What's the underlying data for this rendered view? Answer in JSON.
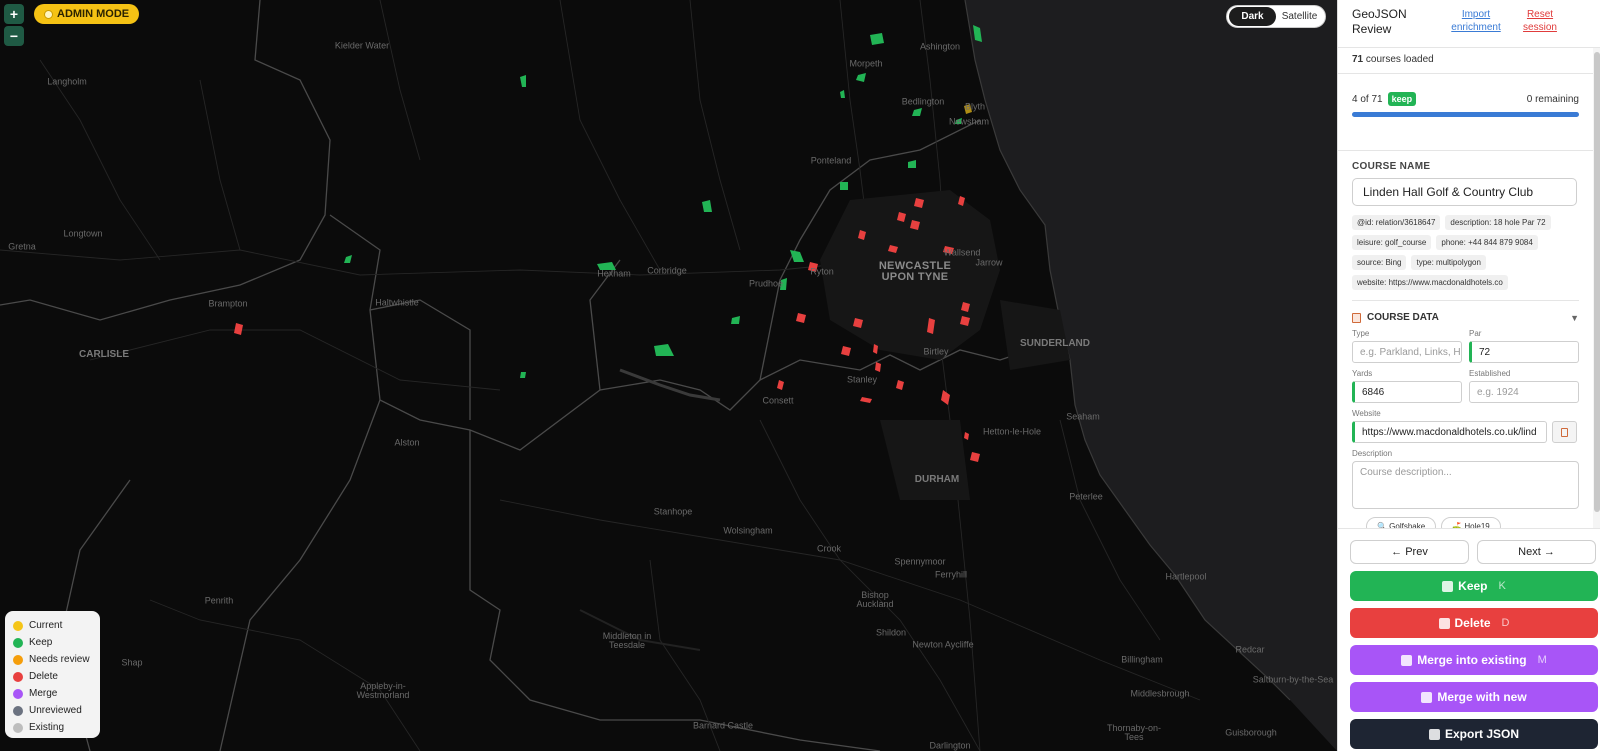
{
  "map": {
    "admin_mode_label": "ADMIN MODE",
    "zoom_in": "+",
    "zoom_out": "−",
    "style_options": [
      "Dark",
      "Satellite"
    ],
    "active_style": "Dark",
    "places": {
      "newcastle": "NEWCASTLE UPON TYNE",
      "sunderland": "SUNDERLAND",
      "durham": "DURHAM",
      "carlisle": "CARLISLE",
      "ashington": "Ashington",
      "morpeth": "Morpeth",
      "bedlington": "Bedlington",
      "blyth": "Blyth",
      "newsham": "Newsham",
      "ponteland": "Ponteland",
      "wallsend": "Wallsend",
      "jarrow": "Jarrow",
      "ryton": "Ryton",
      "prudhoe": "Prudhoe",
      "hexham": "Hexham",
      "corbridge": "Corbridge",
      "haltwhistle": "Haltwhistle",
      "brampton": "Brampton",
      "longtown": "Longtown",
      "langholm": "Langholm",
      "gretna": "Gretna",
      "kielder": "Kielder Water",
      "birtley": "Birtley",
      "stanley": "Stanley",
      "consett": "Consett",
      "alston": "Alston",
      "seaham": "Seaham",
      "houghton": "Hetton-le-Hole",
      "peterlee": "Peterlee",
      "stanhope": "Stanhope",
      "wolsingham": "Wolsingham",
      "crook": "Crook",
      "spennymoor": "Spennymoor",
      "ferryhill": "Ferryhill",
      "bishop": "Bishop Auckland",
      "shildon": "Shildon",
      "newton": "Newton Aycliffe",
      "hartlepool": "Hartlepool",
      "penrith": "Penrith",
      "middleton": "Middleton in Teesdale",
      "appleby": "Appleby-in-Westmorland",
      "barnard": "Barnard Castle",
      "darlington": "Darlington",
      "billingham": "Billingham",
      "middlesbrough": "Middlesbrough",
      "thornaby": "Thornaby-on-Tees",
      "guisborough": "Guisborough",
      "saltburn": "Saltburn-by-the-Sea",
      "redcar": "Redcar",
      "shap": "Shap"
    },
    "legend": [
      {
        "label": "Current",
        "color": "#f5c518"
      },
      {
        "label": "Keep",
        "color": "#22b455"
      },
      {
        "label": "Needs review",
        "color": "#f59e0b"
      },
      {
        "label": "Delete",
        "color": "#e8403f"
      },
      {
        "label": "Merge",
        "color": "#a855f7"
      },
      {
        "label": "Unreviewed",
        "color": "#6b7280"
      },
      {
        "label": "Existing",
        "color": "#bdbdbd"
      }
    ]
  },
  "panel": {
    "title": "GeoJSON Review",
    "import_link": "Import enrichment",
    "reset_link": "Reset session",
    "loaded_count": "71",
    "loaded_suffix": "courses loaded",
    "position": "4 of 71",
    "status_badge": "keep",
    "remaining": "0 remaining",
    "progress": 1.0,
    "course_name_label": "COURSE NAME",
    "course_name": "Linden Hall Golf & Country Club",
    "tags": [
      "@id: relation/3618647",
      "description: 18 hole Par 72",
      "leisure: golf_course",
      "phone: +44 844 879 9084",
      "source: Bing",
      "type: multipolygon",
      "website: https://www.macdonaldhotels.co"
    ],
    "course_data_label": "COURSE DATA",
    "fields": {
      "type_label": "Type",
      "type_placeholder": "e.g. Parkland, Links, H",
      "par_label": "Par",
      "par_value": "72",
      "yards_label": "Yards",
      "yards_value": "6846",
      "established_label": "Established",
      "established_placeholder": "e.g. 1924",
      "website_label": "Website",
      "website_value": "https://www.macdonaldhotels.co.uk/lind",
      "description_label": "Description",
      "description_placeholder": "Course description..."
    },
    "external": [
      "🔍 Golfshake",
      "⛳ Hole19"
    ],
    "prev": "← Prev",
    "next": "Next →",
    "keep": {
      "label": "Keep",
      "key": "K"
    },
    "delete": {
      "label": "Delete",
      "key": "D"
    },
    "merge_existing": {
      "label": "Merge into existing",
      "key": "M"
    },
    "merge_new": {
      "label": "Merge with new"
    },
    "export": {
      "label": "Export JSON"
    }
  }
}
